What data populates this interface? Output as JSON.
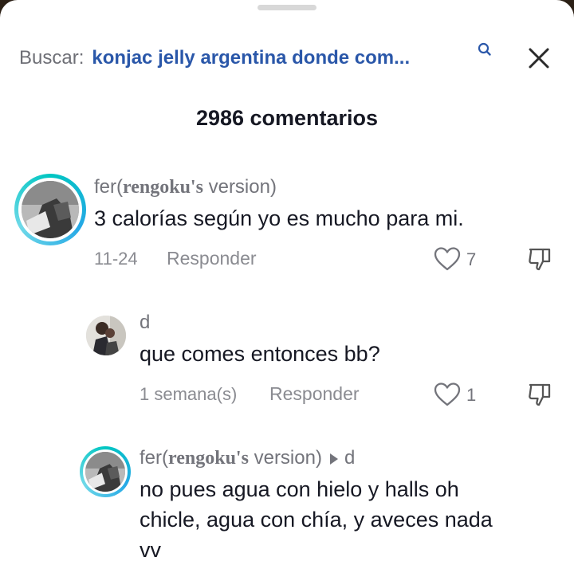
{
  "search": {
    "prefix": "Buscar:",
    "query": "konjac jelly argentina donde com..."
  },
  "header": {
    "count_label": "2986 comentarios"
  },
  "icons": {
    "search": "search-icon",
    "close": "close-icon",
    "like": "heart-icon",
    "dislike": "thumbs-down-icon",
    "reply_arrow": "triangle-right-icon"
  },
  "colors": {
    "query_blue": "#2a57a9",
    "ring_cyan": "#00c6c1",
    "muted": "#8a8b91"
  },
  "comments": [
    {
      "user_prefix": "fer(",
      "user_serif": "rengoku's",
      "user_suffix": " version)",
      "text": "3 calorías según yo es mucho para mi.",
      "date": "11-24",
      "reply_label": "Responder",
      "likes": "7"
    },
    {
      "user": "d",
      "text": "que comes entonces bb?",
      "date": "1 semana(s)",
      "reply_label": "Responder",
      "likes": "1"
    },
    {
      "user_prefix": "fer(",
      "user_serif": "rengoku's",
      "user_suffix": " version)",
      "reply_to": "d",
      "text_lines": [
        "no pues agua con hielo y halls oh",
        "chicle, agua con chía, y aveces nada",
        "vv"
      ]
    }
  ]
}
